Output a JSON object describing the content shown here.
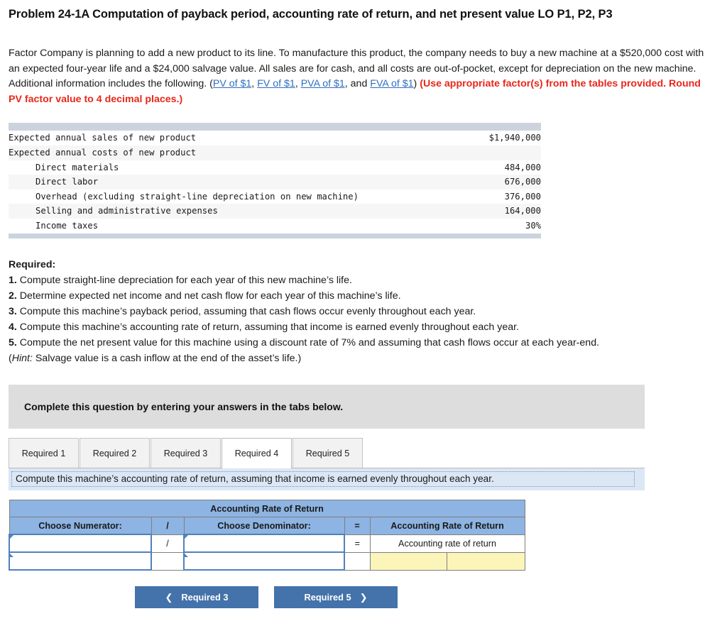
{
  "problem": {
    "title": "Problem 24-1A Computation of payback period, accounting rate of return, and net present value LO P1, P2, P3"
  },
  "intro": {
    "part1": "Factor Company is planning to add a new product to its line. To manufacture this product, the company needs to buy a new machine at a $520,000 cost with an expected four-year life and a $24,000 salvage value. All sales are for cash, and all costs are out-of-pocket, except for depreciation on the new machine. Additional information includes the following. (",
    "link1": "PV of $1",
    "sep1": ", ",
    "link2": "FV of $1",
    "sep2": ", ",
    "link3": "PVA of $1",
    "sep3": ", and ",
    "link4": "FVA of $1",
    "closeparen": ") ",
    "red_note": "(Use appropriate factor(s) from the tables provided. Round PV factor value to 4 decimal places.)"
  },
  "facts_table": {
    "rows": [
      {
        "label": "Expected annual sales of new product",
        "value": "$1,940,000",
        "indent": false
      },
      {
        "label": "Expected annual costs of new product",
        "value": "",
        "indent": false
      },
      {
        "label": "Direct materials",
        "value": "484,000",
        "indent": true
      },
      {
        "label": "Direct labor",
        "value": "676,000",
        "indent": true
      },
      {
        "label": "Overhead (excluding straight-line depreciation on new machine)",
        "value": "376,000",
        "indent": true
      },
      {
        "label": "Selling and administrative expenses",
        "value": "164,000",
        "indent": true
      },
      {
        "label": "Income taxes",
        "value": "30%",
        "indent": true
      }
    ]
  },
  "required": {
    "heading": "Required:",
    "items": [
      {
        "num": "1.",
        "text": " Compute straight-line depreciation for each year of this new machine’s life."
      },
      {
        "num": "2.",
        "text": " Determine expected net income and net cash flow for each year of this machine’s life."
      },
      {
        "num": "3.",
        "text": " Compute this machine’s payback period, assuming that cash flows occur evenly throughout each year."
      },
      {
        "num": "4.",
        "text": " Compute this machine’s accounting rate of return, assuming that income is earned evenly throughout each year."
      },
      {
        "num": "5.",
        "text": " Compute the net present value for this machine using a discount rate of 7% and assuming that cash flows occur at each year-end."
      }
    ],
    "hint_label": "Hint:",
    "hint_text": " Salvage value is a cash inflow at the end of the asset’s life.)",
    "hint_open": "("
  },
  "banner": {
    "text": "Complete this question by entering your answers in the tabs below."
  },
  "tabs": [
    {
      "label": "Required 1",
      "active": false
    },
    {
      "label": "Required 2",
      "active": false
    },
    {
      "label": "Required 3",
      "active": false
    },
    {
      "label": "Required 4",
      "active": true
    },
    {
      "label": "Required 5",
      "active": false
    }
  ],
  "prompt": {
    "text": "Compute this machine’s accounting rate of return, assuming that income is earned evenly throughout each year."
  },
  "arr_table": {
    "title": "Accounting Rate of Return",
    "headers": {
      "numerator": "Choose Numerator:",
      "slash": "/",
      "denominator": "Choose Denominator:",
      "equals": "=",
      "result": "Accounting Rate of Return"
    },
    "row1": {
      "numerator_value": "",
      "slash": "/",
      "denominator_value": "",
      "equals": "=",
      "result_label": "Accounting rate of return"
    },
    "row2": {
      "numerator_value": "",
      "slash": "",
      "denominator_value": "",
      "equals": "",
      "result_value_a": "",
      "result_value_b": ""
    }
  },
  "nav": {
    "prev_label": "Required 3",
    "prev_icon": "chevron-left-icon",
    "next_label": "Required 5",
    "next_icon": "chevron-right-icon"
  },
  "colors": {
    "link": "#2f6fc0",
    "red_note": "#e8271a",
    "table_header_blue": "#8db4e2",
    "answer_yellow": "#fcf5ba",
    "button_blue": "#4472aa",
    "banner_grey": "#dddddd",
    "prompt_blue": "#dce7f5"
  }
}
